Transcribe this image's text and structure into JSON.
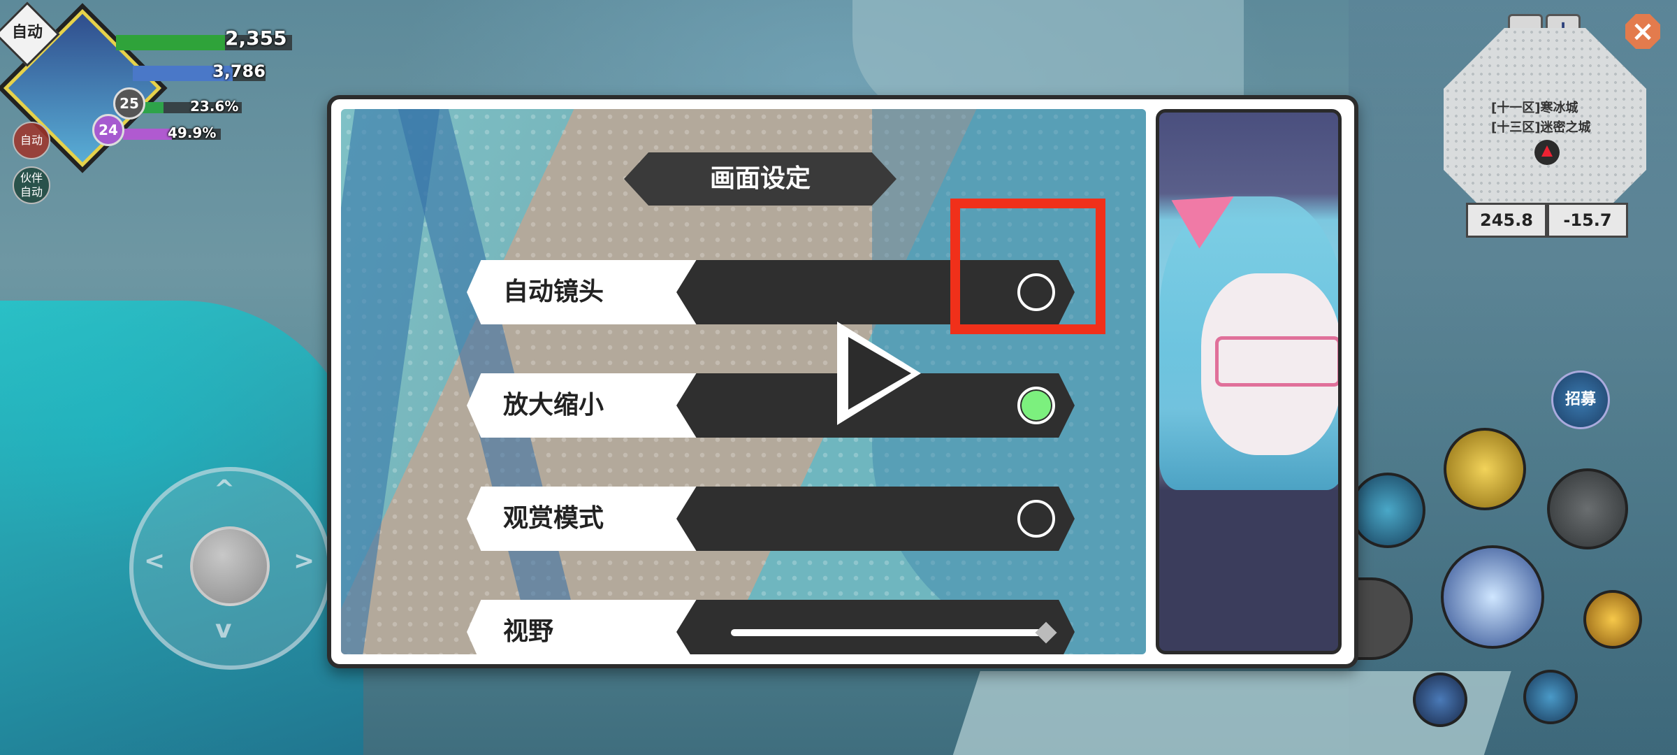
{
  "hud": {
    "auto_label": "自动",
    "hp_value": "2,355",
    "mp_value": "3,786",
    "exp_value": "23.6%",
    "partner_exp_value": "49.9%",
    "level": "25",
    "partner_level": "24",
    "auto_button": "自动",
    "partner_auto_button": "伙伴\n自动",
    "hp_fraction": 0.62,
    "mp_fraction": 0.75,
    "exp_fraction": 0.236,
    "partner_exp_fraction": 0.499,
    "colors": {
      "hp": "#2fa33a",
      "mp": "#4a78c8",
      "exp": "#2ea34a",
      "partner_exp": "#b05ad0"
    }
  },
  "minimap": {
    "zoom_out": "−",
    "zoom_in": "+",
    "line1": "[十一区]寒冰城",
    "line2": "[十三区]迷密之城",
    "coord_x": "245.8",
    "coord_y": "-15.7",
    "close_icon": "close-icon"
  },
  "skills": {
    "recruit_label": "招募"
  },
  "dialog": {
    "title": "画面设定",
    "rows": [
      {
        "label": "自动镜头",
        "type": "toggle",
        "on": false
      },
      {
        "label": "放大缩小",
        "type": "toggle",
        "on": true
      },
      {
        "label": "观赏模式",
        "type": "toggle",
        "on": false
      },
      {
        "label": "视野",
        "type": "slider",
        "value": 1.0
      }
    ],
    "accent_on": "#7cf07e",
    "highlight_color": "#f0301a",
    "play_icon": "play-icon"
  }
}
